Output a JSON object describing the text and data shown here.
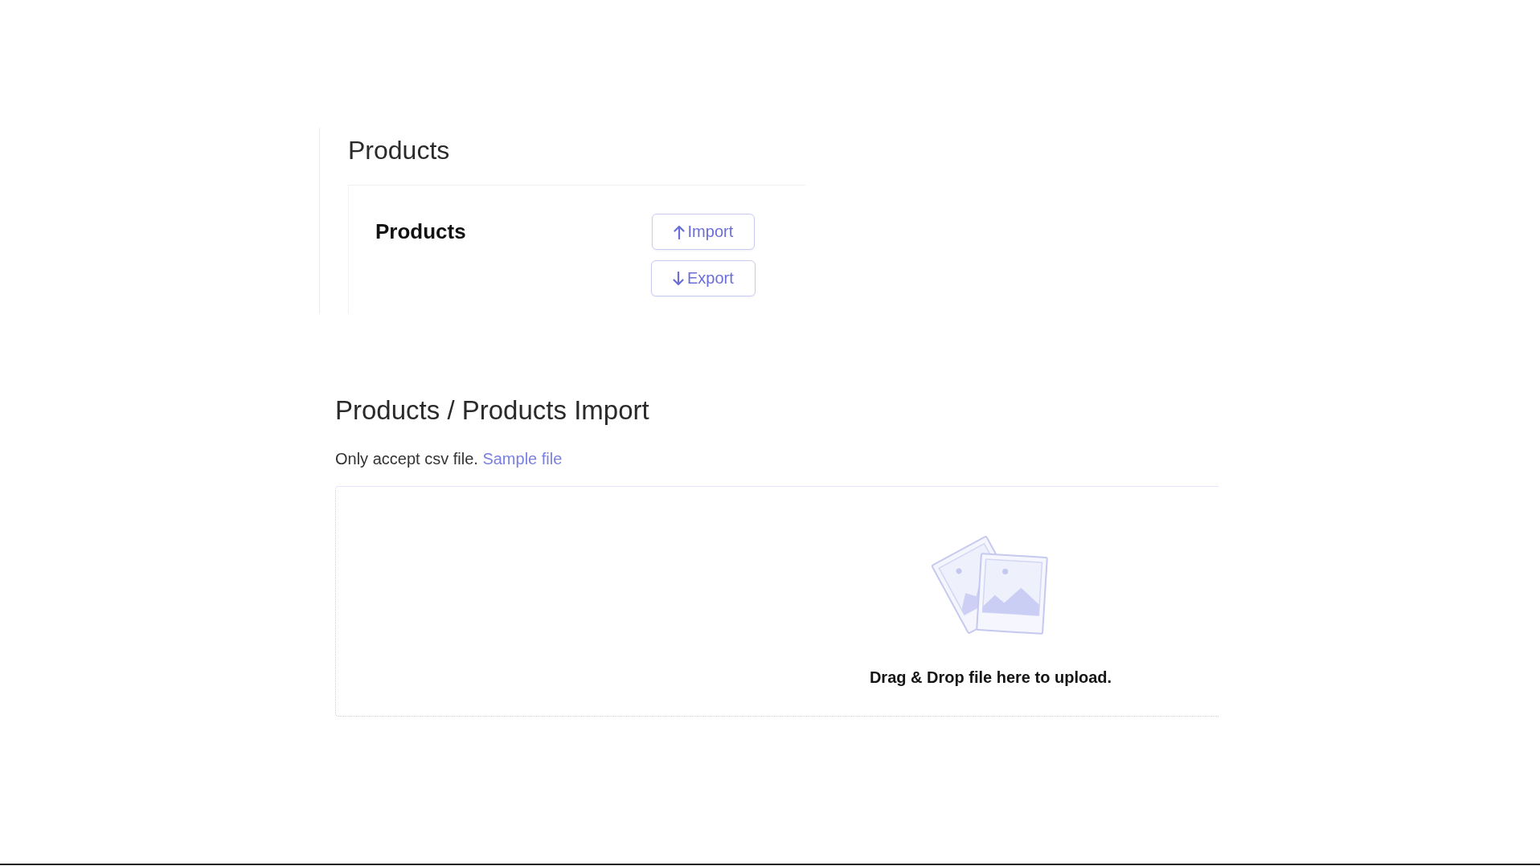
{
  "page_header": {
    "title": "Products"
  },
  "products_card": {
    "title": "Products",
    "buttons": [
      {
        "kind": "import",
        "label": "Import"
      },
      {
        "kind": "export",
        "label": "Export"
      }
    ]
  },
  "import_section": {
    "title": "Products / Products Import",
    "hint": {
      "text": "Only accept csv file.",
      "link": "Sample file"
    },
    "drop_zone": {
      "message": "Drag & Drop file here to upload."
    }
  }
}
